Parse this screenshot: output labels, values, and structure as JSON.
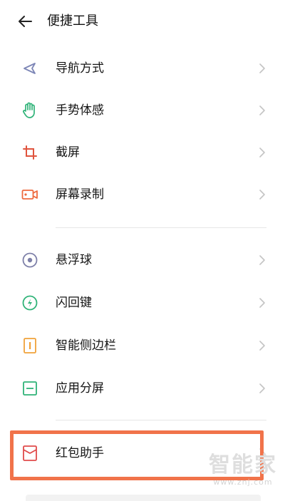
{
  "header": {
    "title": "便捷工具",
    "back_icon": "arrow-left-icon"
  },
  "groups": [
    {
      "items": [
        {
          "label": "导航方式",
          "icon": "navigation-arrow-icon",
          "color": "#7d86b6"
        },
        {
          "label": "手势体感",
          "icon": "hand-gesture-icon",
          "color": "#2fb378"
        },
        {
          "label": "截屏",
          "icon": "crop-icon",
          "color": "#e0543e"
        },
        {
          "label": "屏幕录制",
          "icon": "video-camera-icon",
          "color": "#ee6a3e"
        }
      ]
    },
    {
      "items": [
        {
          "label": "悬浮球",
          "icon": "floating-ball-icon",
          "color": "#7d7fa8"
        },
        {
          "label": "闪回键",
          "icon": "flash-icon",
          "color": "#2fb378"
        },
        {
          "label": "智能侧边栏",
          "icon": "sidebar-icon",
          "color": "#f0a23a"
        },
        {
          "label": "应用分屏",
          "icon": "split-screen-icon",
          "color": "#2fb378"
        }
      ]
    },
    {
      "items": [
        {
          "label": "红包助手",
          "icon": "red-envelope-icon",
          "color": "#e04b4b"
        }
      ]
    }
  ],
  "highlight_color": "#f1734a",
  "watermark": {
    "main": "智能家",
    "sub": "www.znj.com"
  }
}
